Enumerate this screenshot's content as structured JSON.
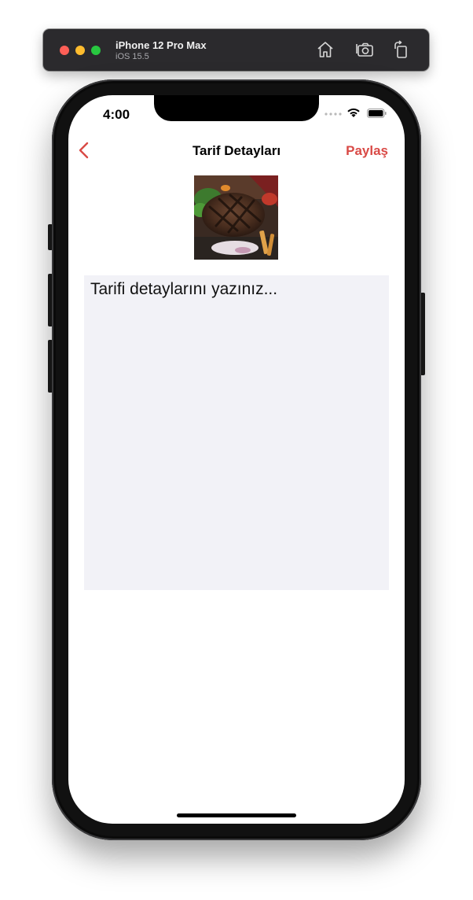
{
  "simulator": {
    "device_name": "iPhone 12 Pro Max",
    "os_version": "iOS 15.5",
    "icons": [
      "home-icon",
      "screenshot-icon",
      "rotate-icon"
    ]
  },
  "status_bar": {
    "time": "4:00",
    "icons": [
      "cellular-dots-icon",
      "wifi-icon",
      "battery-icon"
    ]
  },
  "nav_bar": {
    "back_icon": "chevron-left-icon",
    "title": "Tarif Detayları",
    "share_label": "Paylaş"
  },
  "content": {
    "image": "grilled-steak-photo",
    "details_placeholder": "Tarifi detaylarını yazınız..."
  },
  "colors": {
    "accent": "#d94a46",
    "text_area_bg": "#f2f2f7",
    "toolbar_bg": "#2b2a2d"
  }
}
